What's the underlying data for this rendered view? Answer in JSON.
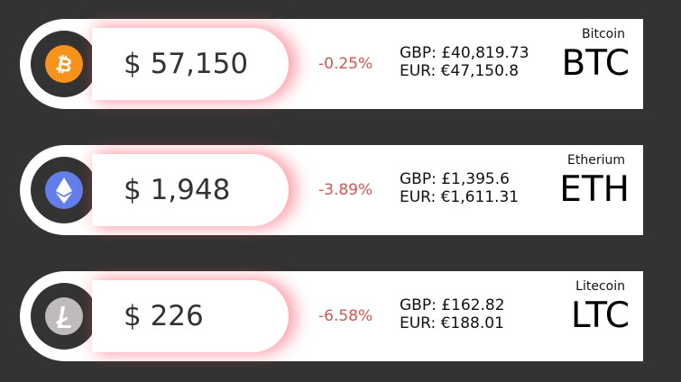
{
  "colors": {
    "background": "#333333",
    "card": "#ffffff",
    "negative_change": "#d9534f",
    "glow": "#ff465a"
  },
  "coins": [
    {
      "name": "Bitcoin",
      "ticker": "BTC",
      "price": "$ 57,150",
      "change": "-0.25%",
      "gbp": "GBP: £40,819.73",
      "eur": "EUR: €47,150.8",
      "icon": "bitcoin-icon",
      "icon_color": "#f7931a"
    },
    {
      "name": "Etherium",
      "ticker": "ETH",
      "price": "$ 1,948",
      "change": "-3.89%",
      "gbp": "GBP: £1,395.6",
      "eur": "EUR: €1,611.31",
      "icon": "ethereum-icon",
      "icon_color": "#627eea"
    },
    {
      "name": "Litecoin",
      "ticker": "LTC",
      "price": "$ 226",
      "change": "-6.58%",
      "gbp": "GBP: £162.82",
      "eur": "EUR: €188.01",
      "icon": "litecoin-icon",
      "icon_color": "#bfbbbb"
    }
  ]
}
